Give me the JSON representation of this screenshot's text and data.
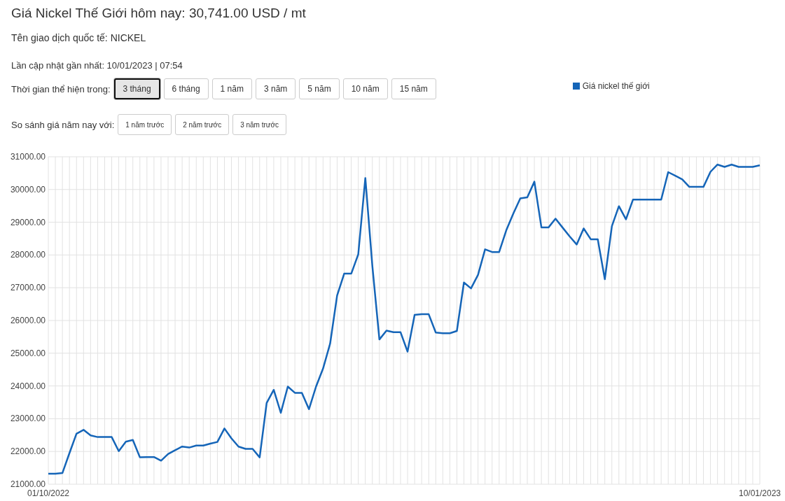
{
  "title": "Giá Nickel Thế Giới hôm nay: 30,741.00 USD / mt",
  "trade_name": "Tên giao dịch quốc tế: NICKEL",
  "last_update": "Lần cập nhật gần nhất: 10/01/2023 | 07:54",
  "period": {
    "label": "Thời gian thể hiện trong:",
    "options": [
      {
        "label": "3 tháng",
        "selected": true
      },
      {
        "label": "6 tháng",
        "selected": false
      },
      {
        "label": "1 năm",
        "selected": false
      },
      {
        "label": "3 năm",
        "selected": false
      },
      {
        "label": "5 năm",
        "selected": false
      },
      {
        "label": "10 năm",
        "selected": false
      },
      {
        "label": "15 năm",
        "selected": false
      }
    ]
  },
  "compare": {
    "label": "So sánh giá năm nay với:",
    "options": [
      "1 năm trước",
      "2 năm trước",
      "3 năm trước"
    ]
  },
  "chart_data": {
    "type": "line",
    "grid": true,
    "ylim": [
      21000,
      31000
    ],
    "categories": [
      "01/10/2022",
      null,
      null,
      null,
      null,
      null,
      null,
      null,
      null,
      null,
      null,
      null,
      null,
      null,
      null,
      null,
      null,
      null,
      null,
      null,
      null,
      null,
      null,
      null,
      null,
      null,
      null,
      null,
      null,
      null,
      null,
      null,
      null,
      null,
      null,
      null,
      null,
      null,
      null,
      null,
      null,
      null,
      null,
      null,
      null,
      null,
      null,
      null,
      null,
      null,
      null,
      null,
      null,
      null,
      null,
      null,
      null,
      null,
      null,
      null,
      null,
      null,
      null,
      null,
      null,
      null,
      null,
      null,
      null,
      null,
      null,
      null,
      null,
      null,
      null,
      null,
      null,
      null,
      null,
      null,
      null,
      null,
      null,
      null,
      null,
      null,
      null,
      null,
      null,
      null,
      null,
      null,
      null,
      null,
      null,
      null,
      null,
      null,
      null,
      null,
      null,
      "10/01/2023"
    ],
    "yticks": [
      {
        "value": 21000,
        "label": "21000.00"
      },
      {
        "value": 22000,
        "label": "22000.00"
      },
      {
        "value": 23000,
        "label": "23000.00"
      },
      {
        "value": 24000,
        "label": "24000.00"
      },
      {
        "value": 25000,
        "label": "25000.00"
      },
      {
        "value": 26000,
        "label": "26000.00"
      },
      {
        "value": 27000,
        "label": "27000.00"
      },
      {
        "value": 28000,
        "label": "28000.00"
      },
      {
        "value": 29000,
        "label": "29000.00"
      },
      {
        "value": 30000,
        "label": "30000.00"
      },
      {
        "value": 31000,
        "label": "31000.00"
      }
    ],
    "series": [
      {
        "name": "Giá nickel thế giới",
        "color": "#1565b8",
        "values": [
          21320,
          21320,
          21340,
          21950,
          22540,
          22660,
          22490,
          22440,
          22440,
          22440,
          22010,
          22300,
          22350,
          21820,
          21830,
          21830,
          21720,
          21920,
          22040,
          22150,
          22120,
          22180,
          22180,
          22240,
          22290,
          22700,
          22400,
          22150,
          22080,
          22080,
          21820,
          23480,
          23880,
          23180,
          23980,
          23790,
          23790,
          23290,
          23980,
          24530,
          25290,
          26760,
          27430,
          27430,
          28020,
          30350,
          27670,
          25420,
          25690,
          25640,
          25640,
          25050,
          26170,
          26190,
          26190,
          25630,
          25610,
          25610,
          25680,
          27160,
          26980,
          27390,
          28170,
          28090,
          28090,
          28750,
          29260,
          29730,
          29760,
          30240,
          28840,
          28840,
          29110,
          28840,
          28570,
          28320,
          28810,
          28480,
          28480,
          27260,
          28880,
          29490,
          29090,
          29690,
          29690,
          29690,
          29690,
          29690,
          30530,
          30420,
          30310,
          30080,
          30080,
          30080,
          30540,
          30760,
          30690,
          30760,
          30690,
          30690,
          30690,
          30740
        ]
      }
    ]
  }
}
